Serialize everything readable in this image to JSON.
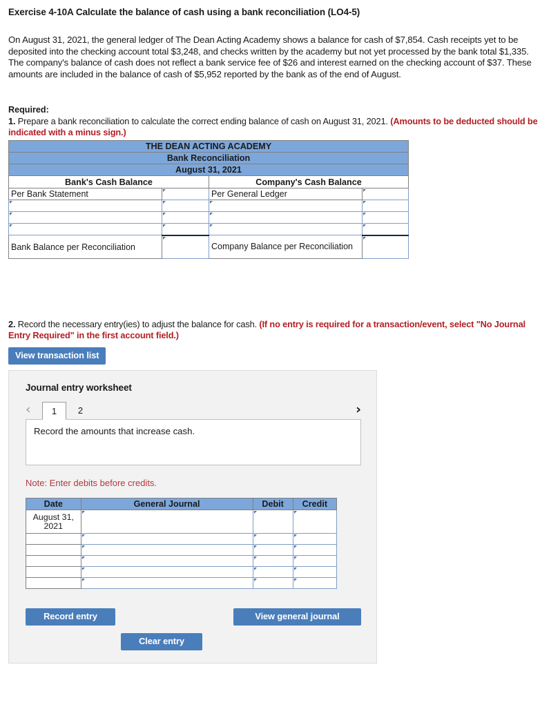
{
  "exercise": {
    "title": "Exercise 4-10A Calculate the balance of cash using a bank reconciliation (LO4-5)",
    "problem": "On August 31, 2021, the general ledger of The Dean Acting Academy shows a balance for cash of $7,854. Cash receipts yet to be deposited into the checking account total $3,248, and checks written by the academy but not yet processed by the bank total $1,335. The company's balance of cash does not reflect a bank service fee of $26 and interest earned on the checking account of $37. These amounts are included in the balance of cash of $5,952 reported by the bank as of the end of August."
  },
  "required": {
    "label": "Required:",
    "item1_number": "1.",
    "item1_text": " Prepare a bank reconciliation to calculate the correct ending balance of cash on August 31, 2021. ",
    "item1_emphasis": "(Amounts to be deducted should be indicated with a minus sign.)",
    "item2_number": "2.",
    "item2_text": " Record the necessary entry(ies) to adjust the balance for cash. ",
    "item2_emphasis": "(If no entry is required for a transaction/event, select \"No Journal Entry Required\" in the first account field.)"
  },
  "reconciliation_table": {
    "company_name": "THE DEAN ACTING ACADEMY",
    "statement_name": "Bank Reconciliation",
    "statement_date": "August 31, 2021",
    "left_header": "Bank's Cash Balance",
    "right_header": "Company's Cash Balance",
    "left_rows": [
      {
        "label": "Per Bank Statement",
        "value": ""
      },
      {
        "label": "",
        "value": ""
      },
      {
        "label": "",
        "value": ""
      },
      {
        "label": "",
        "value": ""
      }
    ],
    "right_rows": [
      {
        "label": "Per General Ledger",
        "value": ""
      },
      {
        "label": "",
        "value": ""
      },
      {
        "label": "",
        "value": ""
      },
      {
        "label": "",
        "value": ""
      }
    ],
    "left_total_label": "Bank Balance per Reconciliation",
    "left_total_value": "",
    "right_total_label": "Company Balance per Reconciliation",
    "right_total_value": ""
  },
  "buttons": {
    "view_transaction_list": "View transaction list",
    "record_entry": "Record entry",
    "clear_entry": "Clear entry",
    "view_general_journal": "View general journal"
  },
  "worksheet": {
    "title": "Journal entry worksheet",
    "prev_icon": "chevron-left-icon",
    "next_icon": "chevron-right-icon",
    "tabs": [
      {
        "label": "1",
        "active": true
      },
      {
        "label": "2",
        "active": false
      }
    ],
    "description": "Record the amounts that increase cash.",
    "note": "Note: Enter debits before credits."
  },
  "journal_table": {
    "headers": [
      "Date",
      "General Journal",
      "Debit",
      "Credit"
    ],
    "rows": [
      {
        "date": "August 31, 2021",
        "account": "",
        "debit": "",
        "credit": ""
      },
      {
        "date": "",
        "account": "",
        "debit": "",
        "credit": ""
      },
      {
        "date": "",
        "account": "",
        "debit": "",
        "credit": ""
      },
      {
        "date": "",
        "account": "",
        "debit": "",
        "credit": ""
      },
      {
        "date": "",
        "account": "",
        "debit": "",
        "credit": ""
      },
      {
        "date": "",
        "account": "",
        "debit": "",
        "credit": ""
      }
    ]
  },
  "colors": {
    "table_header_blue": "#7da7db",
    "button_blue": "#4a7ebb",
    "emphasis_red": "#b32025",
    "note_red": "#b3383d",
    "panel_gray": "#f2f2f2"
  }
}
